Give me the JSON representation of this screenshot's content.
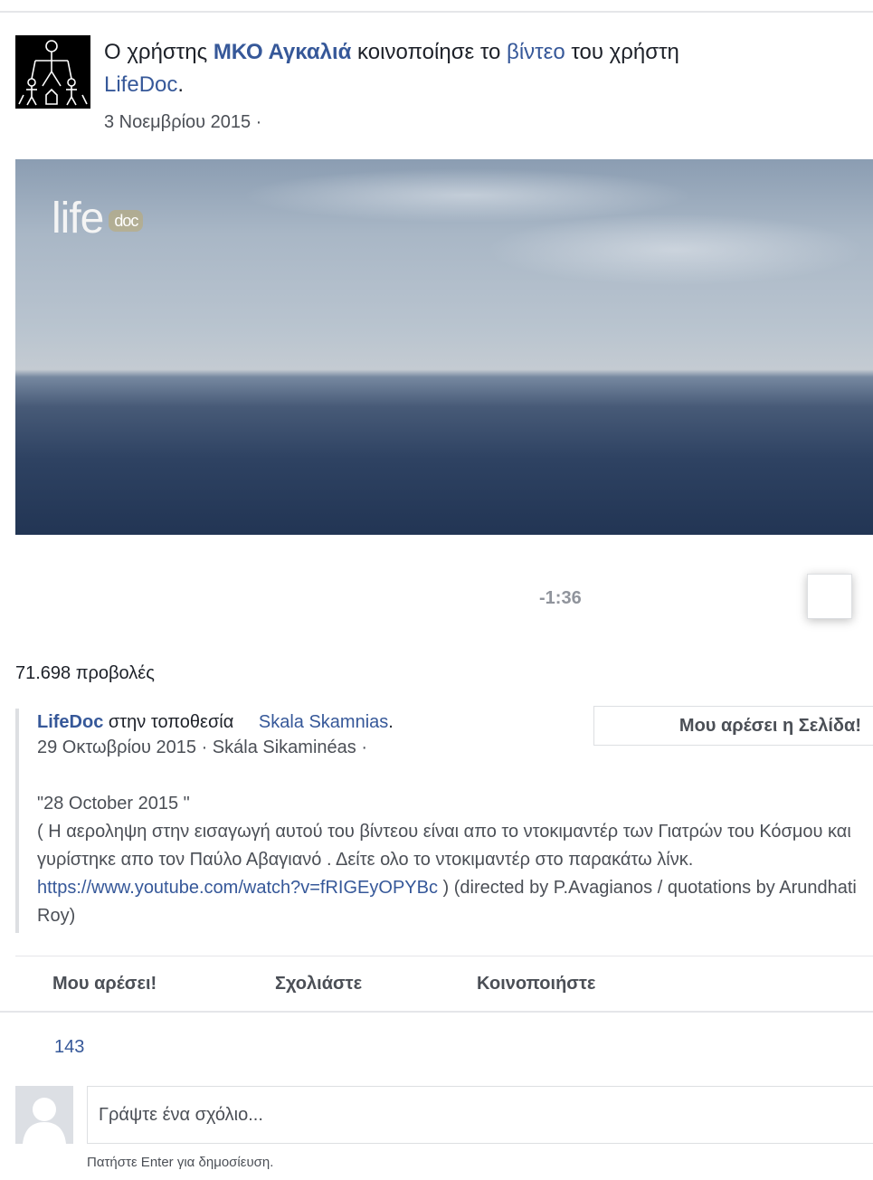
{
  "post": {
    "prefix": "Ο χρήστης ",
    "author": "ΜΚΟ Αγκαλιά",
    "middle": " κοινοποίησε το ",
    "video_link": "βίντεο",
    "suffix": " του χρήστη ",
    "original_author": "LifeDoc",
    "end": ".",
    "date": "3 Νοεμβρίου 2015 ·"
  },
  "video": {
    "logo_text": "life",
    "logo_small": "doc",
    "duration": "-1:36"
  },
  "views": "71.698 προβολές",
  "shared": {
    "page": "LifeDoc",
    "location_prefix": " στην τοποθεσία ",
    "location": "Skala Skamnias",
    "location_end": ".",
    "date": "29 Οκτωβρίου 2015 · Skála Sikaminéas ·",
    "like_page_button": "Μου αρέσει η Σελίδα!",
    "text_before_link": "\"28 October 2015 \"\n( Η αεροληψη στην εισαγωγή αυτού του βίντεου είναι απο το ντοκιμαντέρ των Γιατρών του Κόσμου και γυρίστηκε απο τον Παύλο Αβαγιανό . Δείτε ολο το ντοκιμαντέρ στο παρακάτω λίνκ. ",
    "link": "https://www.youtube.com/watch?v=fRIGEyOPYBc",
    "text_after_link": " ) (directed by P.Avagianos / quotations by Arundhati Roy)"
  },
  "actions": {
    "like": "Μου αρέσει!",
    "comment": "Σχολιάστε",
    "share": "Κοινοποιήστε"
  },
  "likes_count": "143",
  "comment": {
    "placeholder": "Γράψτε ένα σχόλιο...",
    "hint": "Πατήστε Enter για δημοσίευση."
  }
}
